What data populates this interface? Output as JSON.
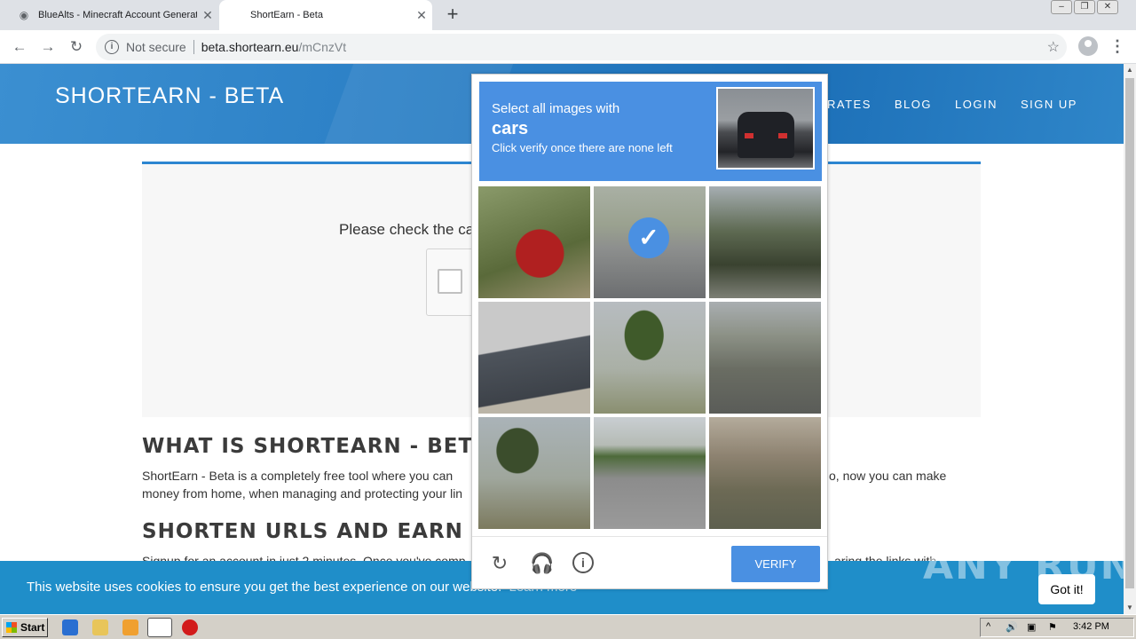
{
  "browser": {
    "tabs": [
      {
        "title": "BlueAlts - Minecraft Account Generat",
        "active": false
      },
      {
        "title": "ShortEarn - Beta",
        "active": true
      }
    ],
    "new_tab_icon": "+",
    "address": {
      "security": "Not secure",
      "host": "beta.shortearn.eu",
      "path": "/mCnzVt"
    }
  },
  "site": {
    "brand": "SHORTEARN - BETA",
    "nav": [
      "RATES",
      "BLOG",
      "LOGIN",
      "SIGN UP"
    ],
    "check_message": "Please check the ca",
    "heading1": "WHAT IS SHORTEARN - BETA?",
    "para1_line1": "ShortEarn - Beta is a completely free tool where you can",
    "para1_line1_right": "o, now you can make",
    "para1_line2": "money from home, when managing and protecting your lin",
    "heading2": "SHORTEN URLS AND EARN MO",
    "para2_left": "Signup for an account in just 2 minutes. Once you've comp",
    "para2_right": "aring the links with"
  },
  "cookie_bar": {
    "text": "This website uses cookies to ensure you get the best experience on our website.",
    "learn_more": "Learn more",
    "button": "Got it!",
    "bg_color": "#1f8ec9"
  },
  "watermark": "ANY RUN",
  "captcha": {
    "instruction_line1": "Select all images with",
    "target": "cars",
    "instruction_line3": "Click verify once there are none left",
    "tiles": [
      {
        "subject": "fire hydrant",
        "selected": false
      },
      {
        "subject": "parked van",
        "selected": true
      },
      {
        "subject": "trees and fence",
        "selected": false
      },
      {
        "subject": "house roof",
        "selected": false
      },
      {
        "subject": "palm tree",
        "selected": false
      },
      {
        "subject": "road with cars",
        "selected": false
      },
      {
        "subject": "palm tree house",
        "selected": false
      },
      {
        "subject": "road with car",
        "selected": false
      },
      {
        "subject": "building wall",
        "selected": false
      }
    ],
    "verify_label": "VERIFY",
    "accent": "#4a90e2"
  },
  "taskbar": {
    "start_label": "Start",
    "clock": "3:42 PM"
  }
}
